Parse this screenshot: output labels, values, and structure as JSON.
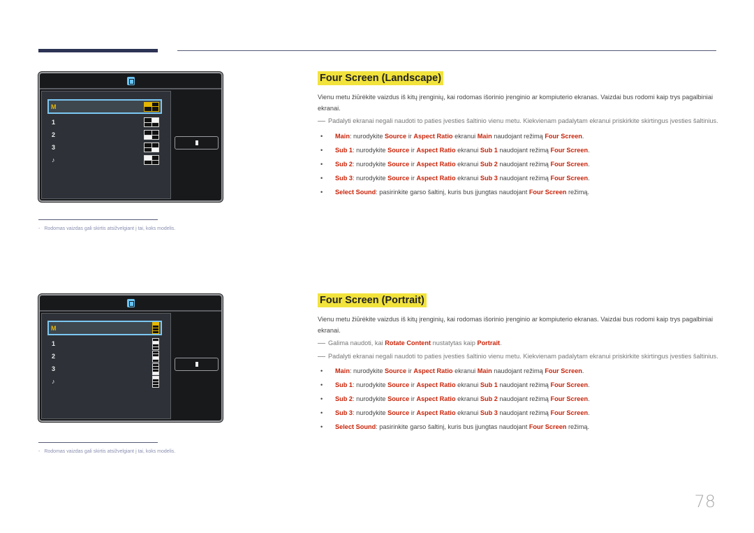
{
  "page_number": "78",
  "footnote": {
    "dash": "-",
    "text": "Rodomas vaizdas gali skirtis atsižvelgiant į tai, koks modelis."
  },
  "osd_landscape": {
    "header_icon": "four-screen-icon",
    "rows": [
      {
        "label": "M",
        "icon": "main-icon",
        "selected": true
      },
      {
        "label": "1",
        "icon": "sub1-icon",
        "selected": false
      },
      {
        "label": "2",
        "icon": "sub2-icon",
        "selected": false
      },
      {
        "label": "3",
        "icon": "sub3-icon",
        "selected": false
      },
      {
        "label": "♪",
        "icon": "sound-icon",
        "selected": false
      }
    ],
    "side_button_icon": "select-sound-icon"
  },
  "osd_portrait": {
    "header_icon": "four-screen-icon",
    "rows": [
      {
        "label": "M",
        "icon": "main-icon",
        "selected": true
      },
      {
        "label": "1",
        "icon": "sub1-icon",
        "selected": false
      },
      {
        "label": "2",
        "icon": "sub2-icon",
        "selected": false
      },
      {
        "label": "3",
        "icon": "sub3-icon",
        "selected": false
      },
      {
        "label": "♪",
        "icon": "sound-icon",
        "selected": false
      }
    ],
    "side_button_icon": "select-sound-icon"
  },
  "landscape": {
    "title": "Four Screen (Landscape)",
    "description": "Vienu metu žiūrėkite vaizdus iš kitų įrenginių, kai rodomas išorinio įrenginio ar kompiuterio ekranas. Vaizdai bus rodomi kaip trys pagalbiniai ekranai.",
    "note": "Padalyti ekranai negali naudoti to paties įvesties šaltinio vienu metu. Kiekvienam padalytam ekranui priskirkite skirtingus įvesties šaltinius.",
    "bullets": [
      {
        "term": "Main",
        "t1": ": nurodykite  ",
        "source": "Source",
        "t2": " ir ",
        "aspect": "Aspect Ratio",
        "t3": " ekranui ",
        "screen": "Main",
        "t4": " naudojant režimą ",
        "mode": "Four Screen",
        "t5": "."
      },
      {
        "term": "Sub 1",
        "t1": ": nurodykite ",
        "source": "Source",
        "t2": " ir ",
        "aspect": "Aspect Ratio",
        "t3": " ekranui ",
        "screen": "Sub 1",
        "t4": " naudojant režimą ",
        "mode": "Four Screen",
        "t5": "."
      },
      {
        "term": "Sub 2",
        "t1": ": nurodykite ",
        "source": "Source",
        "t2": " ir ",
        "aspect": "Aspect Ratio",
        "t3": " ekranui ",
        "screen": "Sub 2",
        "t4": " naudojant režimą ",
        "mode": "Four Screen",
        "t5": "."
      },
      {
        "term": "Sub 3",
        "t1": ": nurodykite ",
        "source": "Source",
        "t2": " ir ",
        "aspect": "Aspect Ratio",
        "t3": " ekranui ",
        "screen": "Sub 3",
        "t4": " naudojant režimą ",
        "mode": "Four Screen",
        "t5": "."
      }
    ],
    "sound_bullet": {
      "term": "Select Sound",
      "t1": ": pasirinkite garso šaltinį, kuris bus įjungtas naudojant ",
      "mode": "Four Screen",
      "t2": " režimą."
    }
  },
  "portrait": {
    "title": "Four Screen (Portrait)",
    "description": "Vienu metu žiūrėkite vaizdus iš kitų įrenginių, kai rodomas išorinio įrenginio ar kompiuterio ekranas. Vaizdai bus rodomi kaip trys pagalbiniai ekranai.",
    "note1": {
      "t1": "Galima naudoti, kai ",
      "setting": "Rotate Content",
      "t2": " nustatytas kaip ",
      "value": "Portrait",
      "t3": "."
    },
    "note2": "Padalyti ekranai negali naudoti to paties įvesties šaltinio vienu metu. Kiekvienam padalytam ekranui priskirkite skirtingus įvesties šaltinius.",
    "bullets": [
      {
        "term": "Main",
        "t1": ": nurodykite  ",
        "source": "Source",
        "t2": " ir ",
        "aspect": "Aspect Ratio",
        "t3": " ekranui ",
        "screen": "Main",
        "t4": " naudojant režimą ",
        "mode": "Four Screen",
        "t5": "."
      },
      {
        "term": "Sub 1",
        "t1": ": nurodykite ",
        "source": "Source",
        "t2": " ir ",
        "aspect": "Aspect Ratio",
        "t3": " ekranui ",
        "screen": "Sub 1",
        "t4": " naudojant režimą ",
        "mode": "Four Screen",
        "t5": "."
      },
      {
        "term": "Sub 2",
        "t1": ": nurodykite ",
        "source": "Source",
        "t2": " ir ",
        "aspect": "Aspect Ratio",
        "t3": " ekranui ",
        "screen": "Sub 2",
        "t4": " naudojant režimą ",
        "mode": "Four Screen",
        "t5": "."
      },
      {
        "term": "Sub 3",
        "t1": ": nurodykite ",
        "source": "Source",
        "t2": " ir ",
        "aspect": "Aspect Ratio",
        "t3": " ekranui ",
        "screen": "Sub 3",
        "t4": " naudojant režimą ",
        "mode": "Four Screen",
        "t5": "."
      }
    ],
    "sound_bullet": {
      "term": "Select Sound",
      "t1": ": pasirinkite garso šaltinį, kuris bus įjungtas naudojant ",
      "mode": "Four Screen",
      "t2": " režimą."
    }
  },
  "colors": {
    "accent_red": "#c8240a",
    "title_highlight": "#f2e33c",
    "osd_selected": "#e5b600",
    "osd_focus_border": "#7cc7f2",
    "header_bar": "#2c3354"
  }
}
